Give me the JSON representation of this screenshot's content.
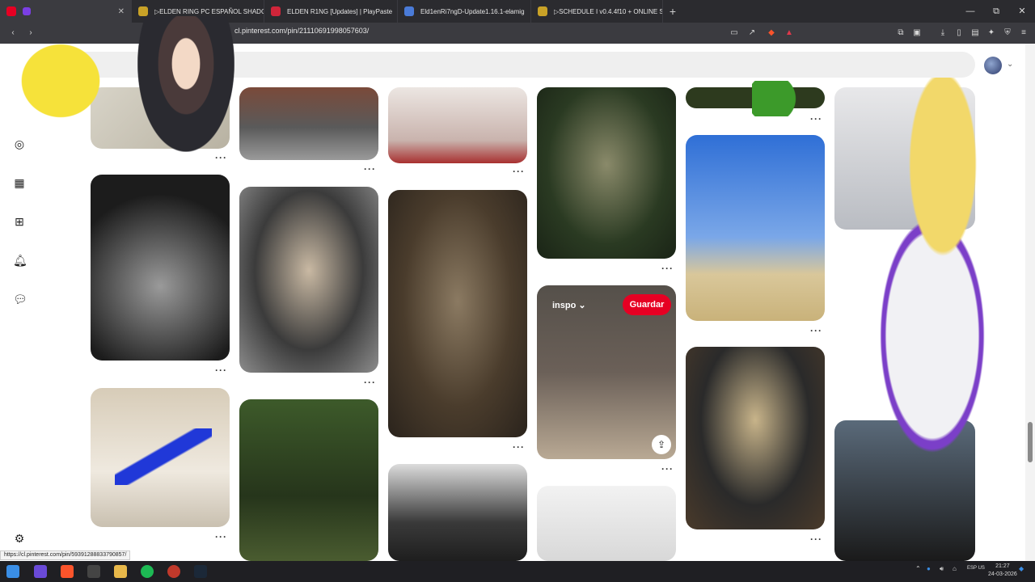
{
  "browser": {
    "tabs": [
      {
        "label": "",
        "favicon_color": "#e60023"
      },
      {
        "label": "▷ELDEN RING PC ESPAÑOL SHADO",
        "favicon_color": "#c9a227"
      },
      {
        "label": "ELDEN R1NG [Updates] | PlayPaste",
        "favicon_color": "#d0253a"
      },
      {
        "label": "Eld1enRi7ngD-Update1.16.1-elamig",
        "favicon_color": "#4a7bd8"
      },
      {
        "label": "▷SCHEDULE I v0.4.4f10 + ONLINE S",
        "favicon_color": "#c9a227"
      }
    ],
    "new_tab": "+",
    "url": "cl.pinterest.com/pin/21110691998057603/",
    "window_controls": [
      "—",
      "⧉",
      "✕"
    ]
  },
  "header": {
    "account_menu": "⌄"
  },
  "pins": {
    "board_label": "inspo",
    "save_label": "Guardar",
    "share_icon": "⇪",
    "more_label": "···"
  },
  "status_bar": {
    "url": "https://cl.pinterest.com/pin/59391288833790857/"
  },
  "taskbar": {
    "language": "ESP\nUS",
    "time": "21:27",
    "date": "24-03-2026"
  },
  "colors": {
    "accent": "#e60023"
  }
}
